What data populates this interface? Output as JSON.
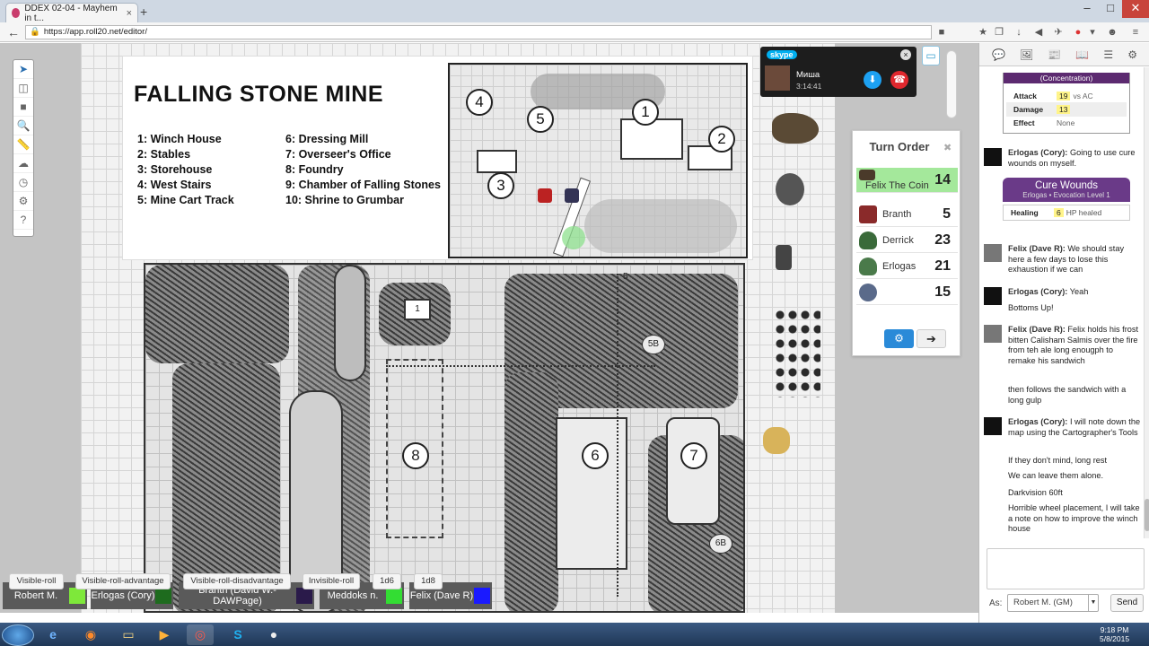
{
  "browser": {
    "tab_title": "DDEX 02-04 - Mayhem in t...",
    "tab_close": "×",
    "new_tab": "+",
    "url": "https://app.roll20.net/editor/",
    "window_controls": [
      "–",
      "□",
      "✕"
    ],
    "back": "←",
    "lock": "🔒",
    "extensions": [
      "■",
      "★",
      "❐",
      "↓",
      "◀",
      "✈",
      "●",
      "▾",
      "☻",
      "≡"
    ]
  },
  "tools": [
    "select-icon",
    "layers-icon",
    "shapes-icon",
    "zoom-icon",
    "measure-icon",
    "fog-icon",
    "turn-icon",
    "dice-icon",
    "help-icon"
  ],
  "tool_glyphs": [
    "➤",
    "◫",
    "■",
    "🔍",
    "📏",
    "☁",
    "◷",
    "⚙",
    "?"
  ],
  "legend": {
    "title": "FALLING STONE MINE",
    "col1": [
      "1: Winch House",
      "2: Stables",
      "3: Storehouse",
      "4: West Stairs",
      "5: Mine Cart Track"
    ],
    "col2": [
      "6: Dressing Mill",
      "7: Overseer's Office",
      "8: Foundry",
      "9: Chamber of Falling Stones",
      "10: Shrine to Grumbar"
    ],
    "map_numbers": [
      "1",
      "2",
      "3",
      "4",
      "5"
    ]
  },
  "main_map": {
    "numbers": [
      "8",
      "6",
      "7"
    ],
    "labels": [
      "5B",
      "6B"
    ],
    "stair_label": "1",
    "track_label": "5"
  },
  "skype": {
    "logo": "skype",
    "name": "Миша",
    "time": "3:14:41",
    "close": "×",
    "mic": "⬇",
    "hangup": "☎"
  },
  "turn_order": {
    "title": "Turn Order",
    "close": "✖",
    "rows": [
      {
        "name": "Felix The Coin",
        "init": "14",
        "color": "#4a3a2a",
        "current": true
      },
      {
        "name": "Branth",
        "init": "5",
        "color": "#8a2a2a",
        "current": false
      },
      {
        "name": "Derrick",
        "init": "23",
        "color": "#3a6a3a",
        "current": false
      },
      {
        "name": "Erlogas",
        "init": "21",
        "color": "#4a7a4a",
        "current": false
      },
      {
        "name": "",
        "init": "15",
        "color": "#5a6a8a",
        "current": false
      }
    ],
    "gear": "⚙",
    "next": "➔"
  },
  "players": [
    {
      "name": "Robert M.",
      "color": "#7ee83a"
    },
    {
      "name": "Erlogas (Cory)",
      "color": "#1e6b1e"
    },
    {
      "name": "Branth (David W.-DAWPage)",
      "color": "#2a1a4a"
    },
    {
      "name": "Meddoks n.",
      "color": "#33dd33"
    },
    {
      "name": "Felix (Dave R)",
      "color": "#1a1aff"
    }
  ],
  "macros": [
    "Visible-roll",
    "Visible-roll-advantage",
    "Visible-roll-disadvantage",
    "Invisible-roll",
    "1d6",
    "1d8"
  ],
  "sidebar": {
    "tabs": [
      "chat-icon",
      "art-icon",
      "journal-icon",
      "compendium-icon",
      "jukebox-icon",
      "settings-icon"
    ],
    "tab_glyphs": [
      "💬",
      "🖼",
      "📰",
      "📖",
      "☰",
      "⚙"
    ],
    "concentration": "(Concentration)",
    "attack_card": [
      {
        "k": "Attack",
        "v": "19",
        "extra": "vs AC"
      },
      {
        "k": "Damage",
        "v": "13",
        "extra": ""
      },
      {
        "k": "Effect",
        "v": "",
        "extra": "None"
      }
    ],
    "messages": [
      {
        "who": "Erlogas (Cory):",
        "text": "Going to use cure wounds on myself."
      },
      {
        "who": "Felix (Dave R):",
        "text": "We should stay here a few days to lose this exhaustion if we can"
      },
      {
        "who": "Erlogas (Cory):",
        "text": "Yeah"
      },
      {
        "who": "",
        "text": "Bottoms Up!"
      },
      {
        "who": "Felix (Dave R):",
        "text": "Felix holds his frost bitten Calisham Salmis over the fire from teh ale long enougph to remake his sandwich"
      },
      {
        "who": "",
        "text": "then follows the sandwich with a long gulp"
      },
      {
        "who": "Erlogas (Cory):",
        "text": "I will note down the map using the Cartographer's Tools"
      },
      {
        "who": "",
        "text": "If they don't mind, long rest"
      },
      {
        "who": "",
        "text": "We can leave them alone."
      },
      {
        "who": "",
        "text": "Darkvision 60ft"
      },
      {
        "who": "",
        "text": "Horrible wheel placement, I will take a note on how to improve the winch house"
      }
    ],
    "spell": {
      "title": "Cure Wounds",
      "subtitle": "Erlogas • Evocation Level 1",
      "row_k": "Healing",
      "row_v": "6",
      "row_extra": "HP healed"
    },
    "as_label": "As:",
    "as_value": "Robert M. (GM)",
    "as_caret": "▼",
    "send": "Send"
  },
  "taskbar": {
    "icons": [
      "ie-icon",
      "firefox-icon",
      "explorer-icon",
      "media-icon",
      "chrome-icon",
      "skype-icon",
      "obs-icon"
    ],
    "glyphs": [
      "e",
      "◉",
      "▭",
      "▶",
      "◎",
      "S",
      "●"
    ],
    "time": "9:18 PM",
    "date": "5/8/2015"
  }
}
